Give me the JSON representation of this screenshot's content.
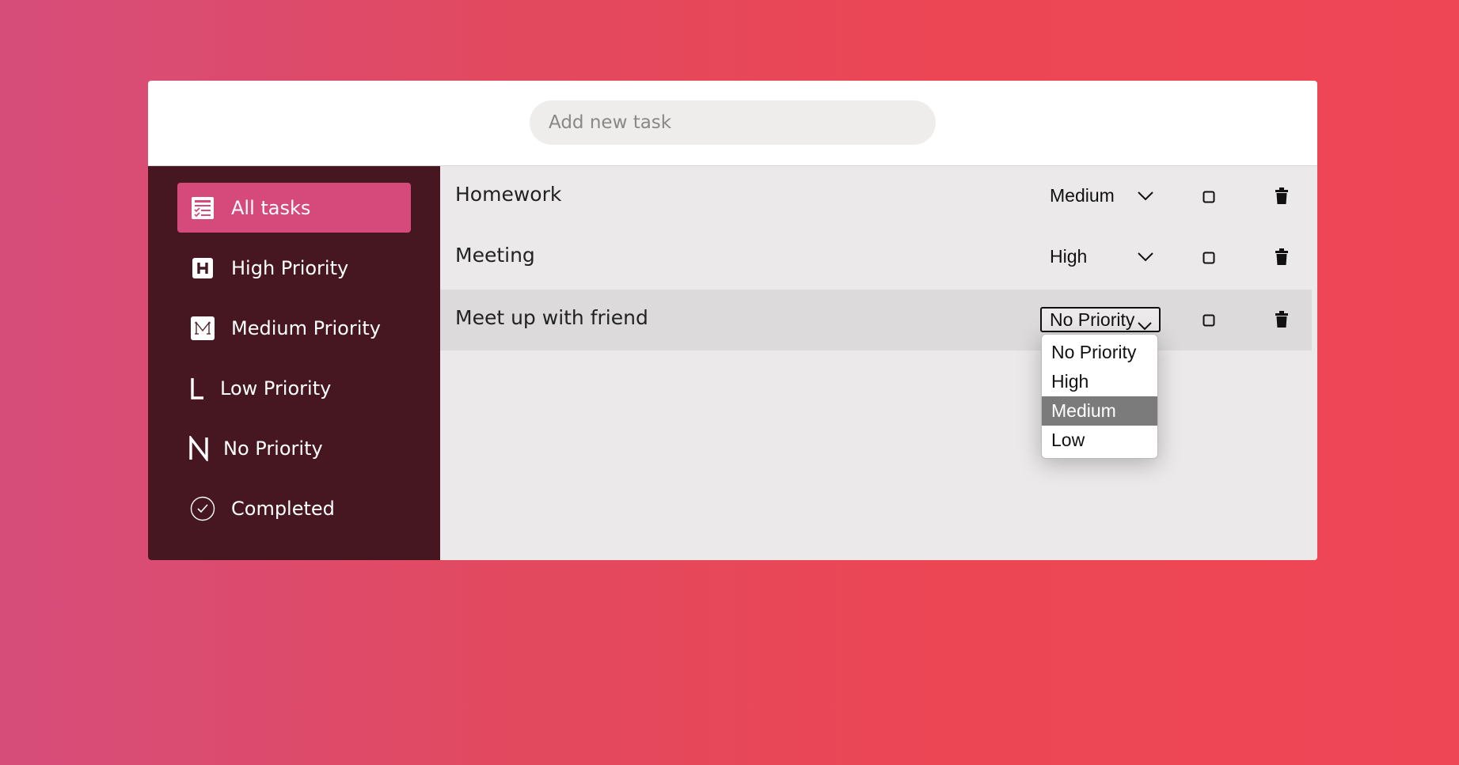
{
  "add_task": {
    "placeholder": "Add new task"
  },
  "sidebar": {
    "items": [
      {
        "label": "All tasks",
        "icon": "all-tasks-icon",
        "active": true
      },
      {
        "label": "High Priority",
        "icon": "h-letter-icon"
      },
      {
        "label": "Medium Priority",
        "icon": "m-letter-icon"
      },
      {
        "label": "Low Priority",
        "icon": "l-letter-icon"
      },
      {
        "label": "No Priority",
        "icon": "n-letter-icon"
      },
      {
        "label": "Completed",
        "icon": "check-circle-icon"
      }
    ]
  },
  "tasks": [
    {
      "title": "Homework",
      "priority": "Medium"
    },
    {
      "title": "Meeting",
      "priority": "High"
    },
    {
      "title": "Meet up with friend",
      "priority": "No Priority"
    }
  ],
  "priority_dropdown": {
    "options": [
      "No Priority",
      "High",
      "Medium",
      "Low"
    ],
    "highlighted": "Medium"
  },
  "colors": {
    "sidebar_bg": "#461721",
    "active_nav": "#d5497b",
    "gradient_start": "#d64d7b",
    "gradient_end": "#ef4656"
  }
}
